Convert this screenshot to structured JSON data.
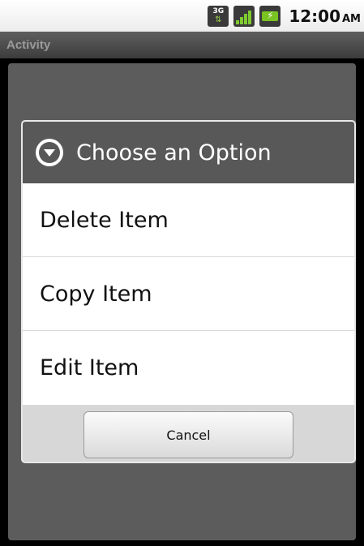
{
  "status_bar": {
    "network_label": "3G",
    "network_icon": "3g-icon",
    "signal_icon": "signal-icon",
    "battery_icon": "battery-charging-icon",
    "time": "12:00",
    "ampm": "AM"
  },
  "app": {
    "title": "Activity"
  },
  "dialog": {
    "icon": "dropdown-circle-icon",
    "title": "Choose an Option",
    "options": [
      {
        "label": "Delete Item"
      },
      {
        "label": "Copy Item"
      },
      {
        "label": "Edit Item"
      }
    ],
    "cancel_label": "Cancel"
  },
  "colors": {
    "header_bg": "#585858",
    "title_bar_text": "#9a9a9a",
    "footer_bg": "#d7d7d7",
    "battery_green": "#79c322"
  }
}
